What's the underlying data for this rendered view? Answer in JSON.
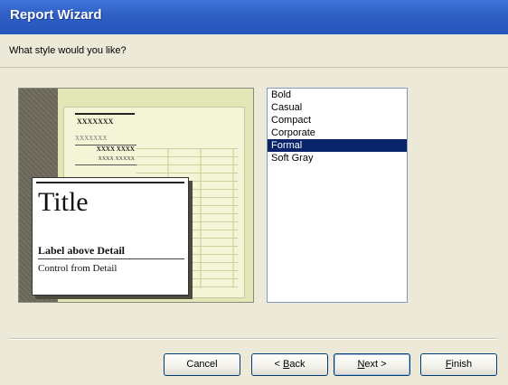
{
  "window": {
    "title": "Report Wizard"
  },
  "prompt": {
    "question": "What style would you like?"
  },
  "preview": {
    "header_text": "XXXXXXX",
    "subheader_text": "XXXXXXX",
    "row1_text": "XXXX XXXX",
    "row2_text": "XXXX XXXXX",
    "title_text": "Title",
    "label_text": "Label above Detail",
    "control_text": "Control from Detail"
  },
  "styles": {
    "items": [
      "Bold",
      "Casual",
      "Compact",
      "Corporate",
      "Formal",
      "Soft Gray"
    ],
    "selected": "Formal"
  },
  "buttons": {
    "cancel": "Cancel",
    "back_pre": "< ",
    "back_key": "B",
    "back_post": "ack",
    "next_key": "N",
    "next_post": "ext >",
    "finish_key": "F",
    "finish_post": "inish"
  },
  "colors": {
    "title_bar": "#2f5fc4",
    "selection": "#0a246a",
    "dialog_bg": "#ece9d8"
  }
}
